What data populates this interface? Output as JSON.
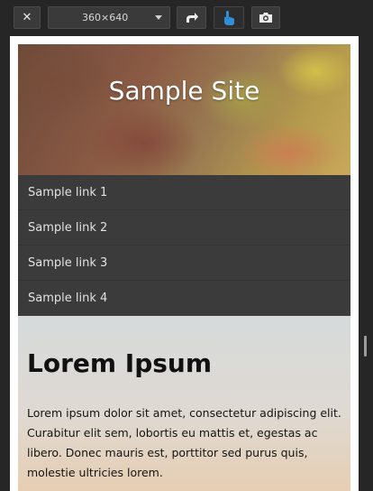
{
  "toolbar": {
    "close_label": "✕",
    "device_size": "360×640"
  },
  "site": {
    "title": "Sample Site",
    "nav": [
      {
        "label": "Sample link 1"
      },
      {
        "label": "Sample link 2"
      },
      {
        "label": "Sample link 3"
      },
      {
        "label": "Sample link 4"
      }
    ],
    "heading": "Lorem Ipsum",
    "paragraph": "Lorem ipsum dolor sit amet, consectetur adipiscing elit. Curabitur elit sem, lobortis eu mattis et, egestas ac libero. Donec mauris est, porttitor sed purus quis, molestie ultricies lorem."
  },
  "colors": {
    "toolbar_bg": "#262626",
    "touch_accent": "#2f8fd8",
    "nav_bg": "#3b3b3b"
  },
  "icons": [
    "close-icon",
    "chevron-down-icon",
    "rotate-icon",
    "touch-icon",
    "camera-icon"
  ]
}
